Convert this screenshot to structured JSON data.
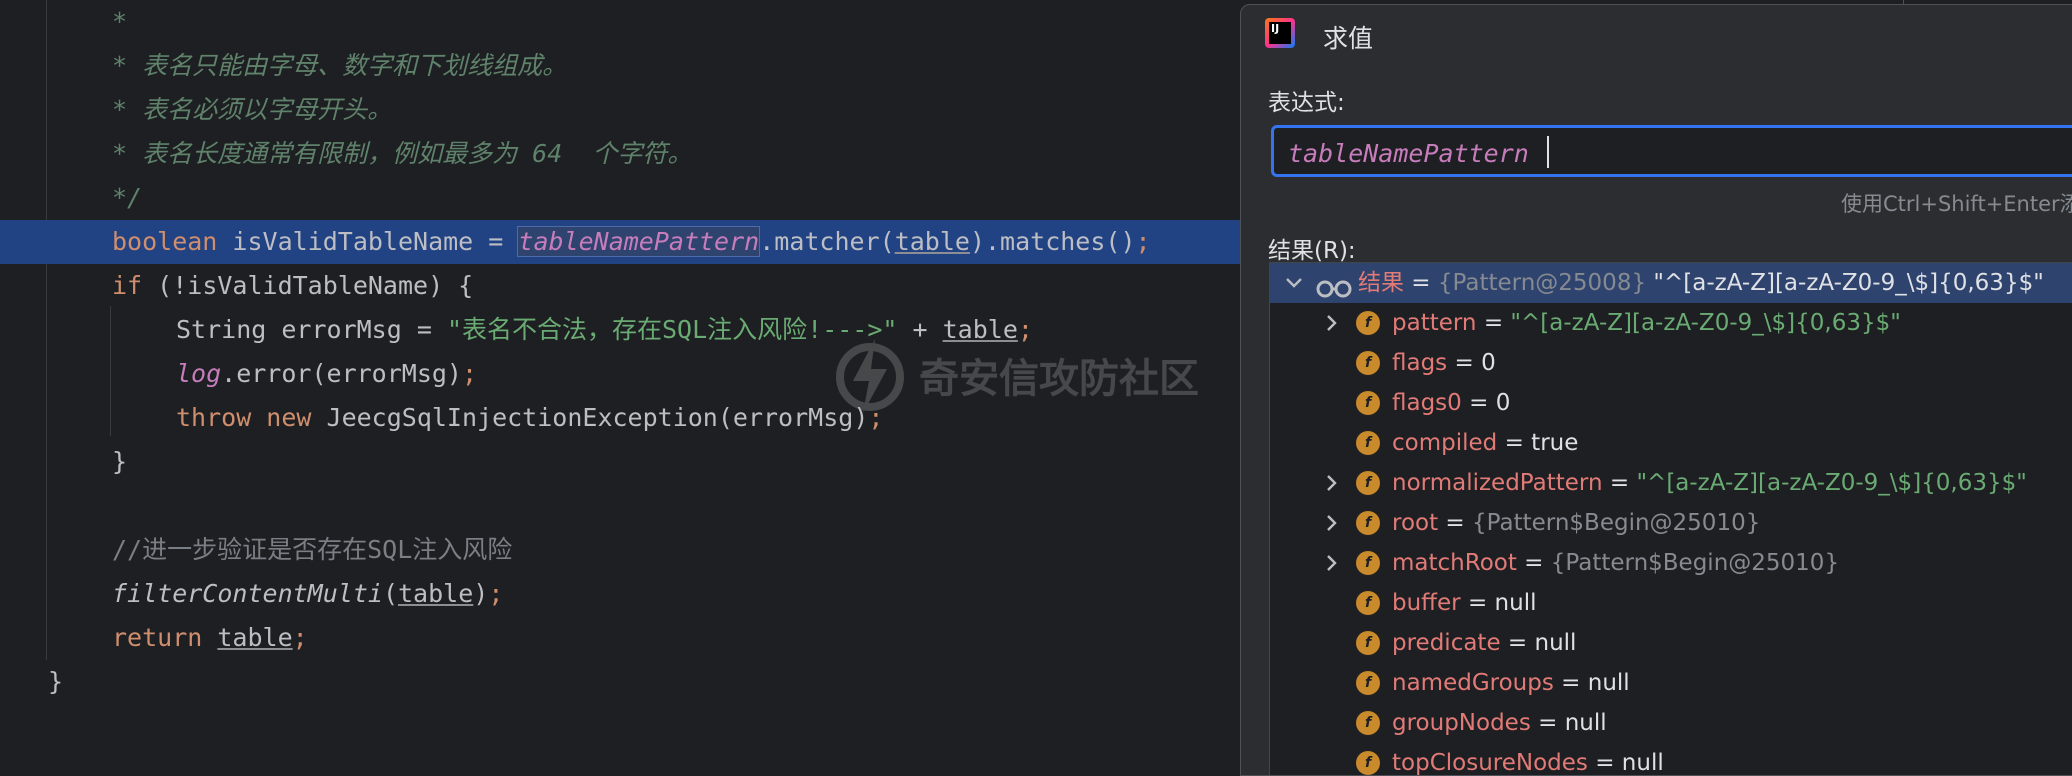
{
  "editor": {
    "comment_lines": [
      "*",
      "* 表名只能由字母、数字和下划线组成。",
      "* 表名必须以字母开头。",
      "* 表名长度通常有限制，例如最多为 64  个字符。",
      "*/"
    ],
    "line_boolean": {
      "kw": "boolean",
      "decl": " isValidTableName = ",
      "field": "tableNamePattern",
      "call": ".matcher(",
      "arg": "table",
      "tail": ").matches()",
      "semi": ";"
    },
    "line_if": {
      "kw": "if",
      "rest": " (!isValidTableName) {"
    },
    "line_string": {
      "type": "String errorMsg = ",
      "str": "\"表名不合法，存在SQL注入风险!--->\"",
      "plus": " + ",
      "var": "table",
      "semi": ";"
    },
    "line_log": {
      "field": "log",
      "rest": ".error(errorMsg)",
      "semi": ";"
    },
    "line_throw": {
      "kw": "throw new",
      "rest": " JeecgSqlInjectionException(errorMsg)",
      "semi": ";"
    },
    "close_brace_inner": "}",
    "line_comment2": "//进一步验证是否存在SQL注入风险",
    "line_filter": {
      "fn": "filterContentMulti",
      "open": "(",
      "arg": "table",
      "close": ")",
      "semi": ";"
    },
    "line_return": {
      "kw": "return",
      "space": " ",
      "var": "table",
      "semi": ";"
    },
    "close_brace_outer": "}"
  },
  "watermark": "奇安信攻防社区",
  "dialog": {
    "title": "求值",
    "app_icon_text": "IJ",
    "expression_label": "表达式:",
    "expression_value": "tableNamePattern",
    "hint": "使用Ctrl+Shift+Enter添",
    "result_label": "结果(R):",
    "tree": [
      {
        "name": "结果",
        "eq": " = ",
        "type": "{Pattern@25008} ",
        "val": "\"^[a-zA-Z][a-zA-Z0-9_\\$]{0,63}$\"",
        "kind": "root",
        "expand": "down",
        "icon": "glasses-icon"
      },
      {
        "name": "pattern",
        "eq": " = ",
        "type": "",
        "val": "\"^[a-zA-Z][a-zA-Z0-9_\\$]{0,63}$\"",
        "kind": "str",
        "expand": "right",
        "icon": "field-icon"
      },
      {
        "name": "flags",
        "eq": " = ",
        "type": "",
        "val": "0",
        "kind": "prim",
        "expand": "",
        "icon": "field-icon"
      },
      {
        "name": "flags0",
        "eq": " = ",
        "type": "",
        "val": "0",
        "kind": "prim",
        "expand": "",
        "icon": "field-icon"
      },
      {
        "name": "compiled",
        "eq": " = ",
        "type": "",
        "val": "true",
        "kind": "prim",
        "expand": "",
        "icon": "field-icon"
      },
      {
        "name": "normalizedPattern",
        "eq": " = ",
        "type": "",
        "val": "\"^[a-zA-Z][a-zA-Z0-9_\\$]{0,63}$\"",
        "kind": "str",
        "expand": "right",
        "icon": "field-icon"
      },
      {
        "name": "root",
        "eq": " = ",
        "type": "{Pattern$Begin@25010}",
        "val": "",
        "kind": "obj",
        "expand": "right",
        "icon": "field-icon"
      },
      {
        "name": "matchRoot",
        "eq": " = ",
        "type": "{Pattern$Begin@25010}",
        "val": "",
        "kind": "obj",
        "expand": "right",
        "icon": "field-icon"
      },
      {
        "name": "buffer",
        "eq": " = ",
        "type": "",
        "val": "null",
        "kind": "prim",
        "expand": "",
        "icon": "field-icon"
      },
      {
        "name": "predicate",
        "eq": " = ",
        "type": "",
        "val": "null",
        "kind": "prim",
        "expand": "",
        "icon": "field-icon"
      },
      {
        "name": "namedGroups",
        "eq": " = ",
        "type": "",
        "val": "null",
        "kind": "prim",
        "expand": "",
        "icon": "field-icon"
      },
      {
        "name": "groupNodes",
        "eq": " = ",
        "type": "",
        "val": "null",
        "kind": "prim",
        "expand": "",
        "icon": "field-icon"
      },
      {
        "name": "topClosureNodes",
        "eq": " = ",
        "type": "",
        "val": "null",
        "kind": "prim",
        "expand": "",
        "icon": "field-icon"
      }
    ]
  }
}
